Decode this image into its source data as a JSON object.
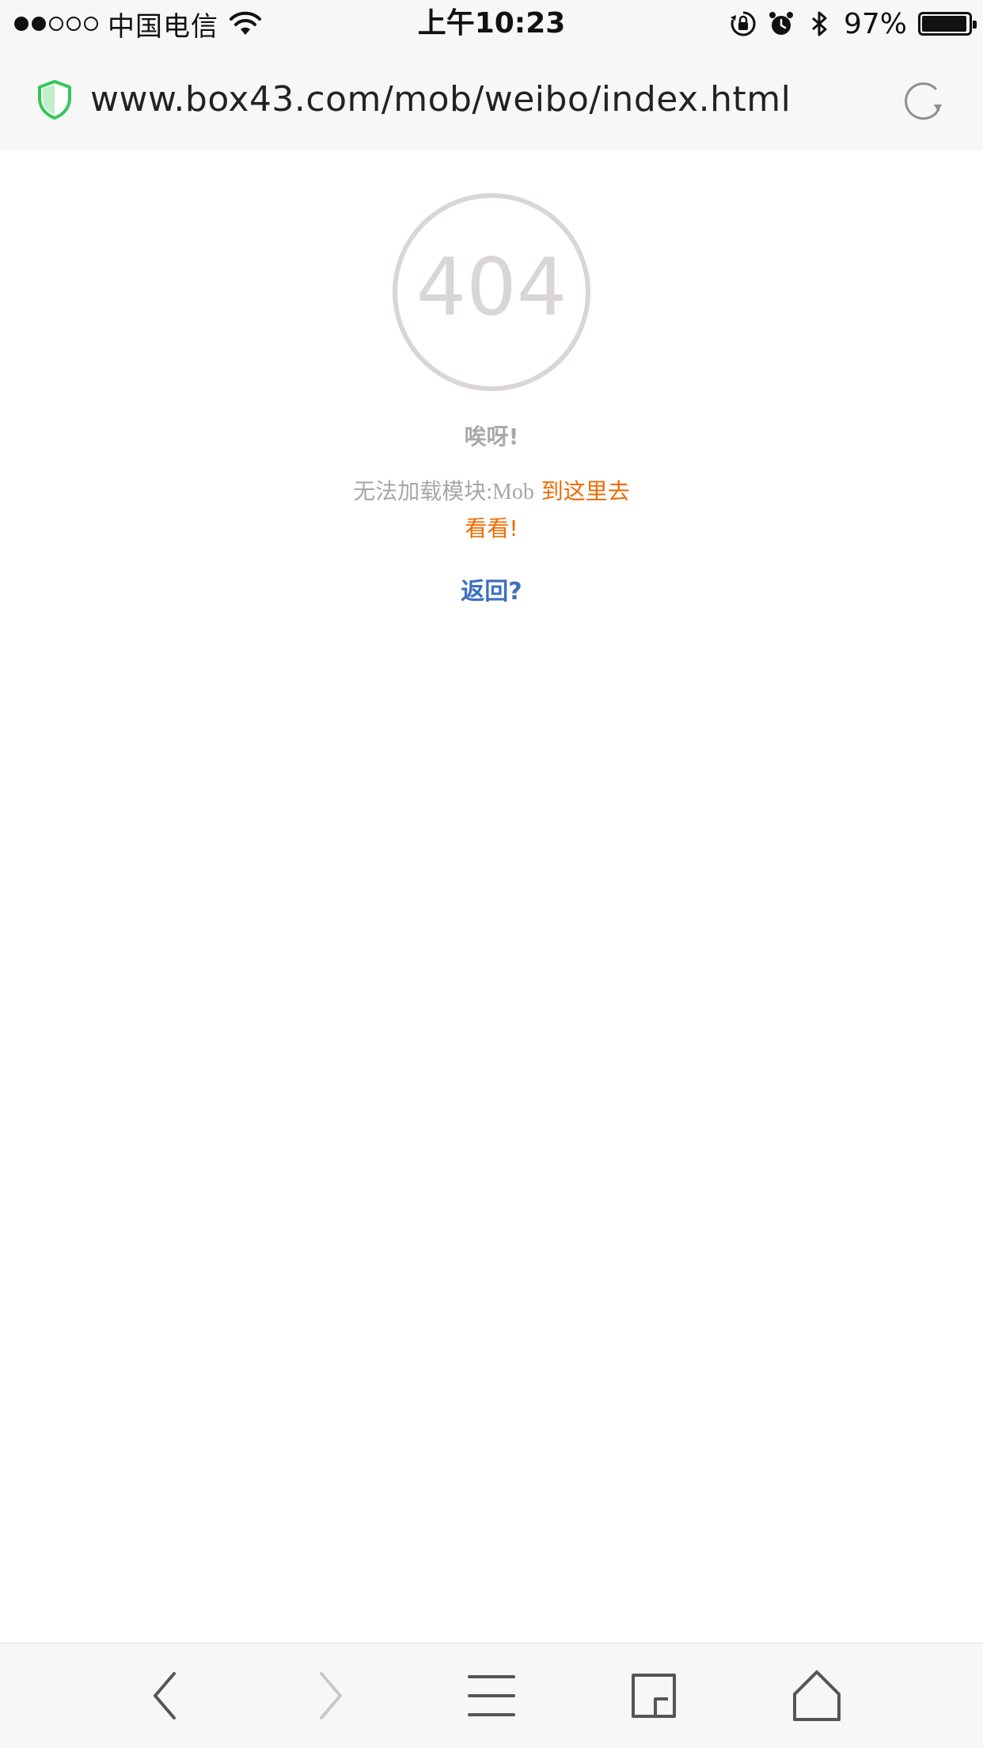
{
  "status_bar": {
    "carrier": "中国电信",
    "time": "上午10:23",
    "battery_percent_label": "97%",
    "battery_level": 0.97,
    "icons": [
      "signal-dots",
      "wifi-icon",
      "rotation-lock-icon",
      "alarm-icon",
      "bluetooth-icon",
      "battery-icon"
    ]
  },
  "address_bar": {
    "url": "www.box43.com/mob/weibo/index.html",
    "icons": [
      "security-shield-icon",
      "reload-icon"
    ],
    "shield_color": "#34c759"
  },
  "error_page": {
    "code": "404",
    "oops": "唉呀!",
    "message": "无法加载模块:Mob",
    "link_text": "到这里去看看!",
    "back_text": "返回?",
    "colors": {
      "link": "#ef6c00",
      "back": "#3f6fc0",
      "muted": "#a7a7aa",
      "badge": "#dad6d6"
    }
  },
  "toolbar": {
    "icons": [
      "back-icon",
      "forward-icon",
      "menu-icon",
      "tabs-icon",
      "home-icon"
    ],
    "forward_enabled": false
  }
}
